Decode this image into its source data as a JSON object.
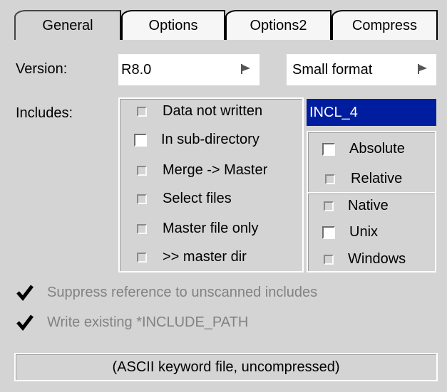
{
  "tabs": [
    {
      "label": "General",
      "active": true
    },
    {
      "label": "Options",
      "active": false
    },
    {
      "label": "Options2",
      "active": false
    },
    {
      "label": "Compress",
      "active": false
    }
  ],
  "version": {
    "label": "Version:",
    "value": "R8.0",
    "arrow_icon": "flag-arrow-icon"
  },
  "format": {
    "value": "Small format",
    "arrow_icon": "flag-arrow-icon"
  },
  "includes": {
    "label": "Includes:",
    "options": [
      {
        "label": "Data not written",
        "checkbox_style": "grey"
      },
      {
        "label": "In sub-directory",
        "checkbox_style": "white"
      },
      {
        "label": "Merge -> Master",
        "checkbox_style": "grey"
      },
      {
        "label": "Select files",
        "checkbox_style": "grey"
      },
      {
        "label": "Master file only",
        "checkbox_style": "grey"
      },
      {
        "label": ">> master dir",
        "checkbox_style": "grey"
      }
    ],
    "dir_name": "INCL_4",
    "path_type": [
      {
        "label": "Absolute",
        "checkbox_style": "white"
      },
      {
        "label": "Relative",
        "checkbox_style": "grey"
      }
    ],
    "os_type": [
      {
        "label": "Native",
        "checkbox_style": "grey"
      },
      {
        "label": "Unix",
        "checkbox_style": "white"
      },
      {
        "label": "Windows",
        "checkbox_style": "grey"
      }
    ]
  },
  "checks": [
    {
      "label": "Suppress reference to unscanned includes",
      "checked": true
    },
    {
      "label": "Write existing *INCLUDE_PATH",
      "checked": true
    }
  ],
  "status": "(ASCII keyword file, uncompressed)",
  "colors": {
    "background": "#d4d4d4",
    "selected_field": "#001d9f",
    "disabled_text": "#828282"
  }
}
